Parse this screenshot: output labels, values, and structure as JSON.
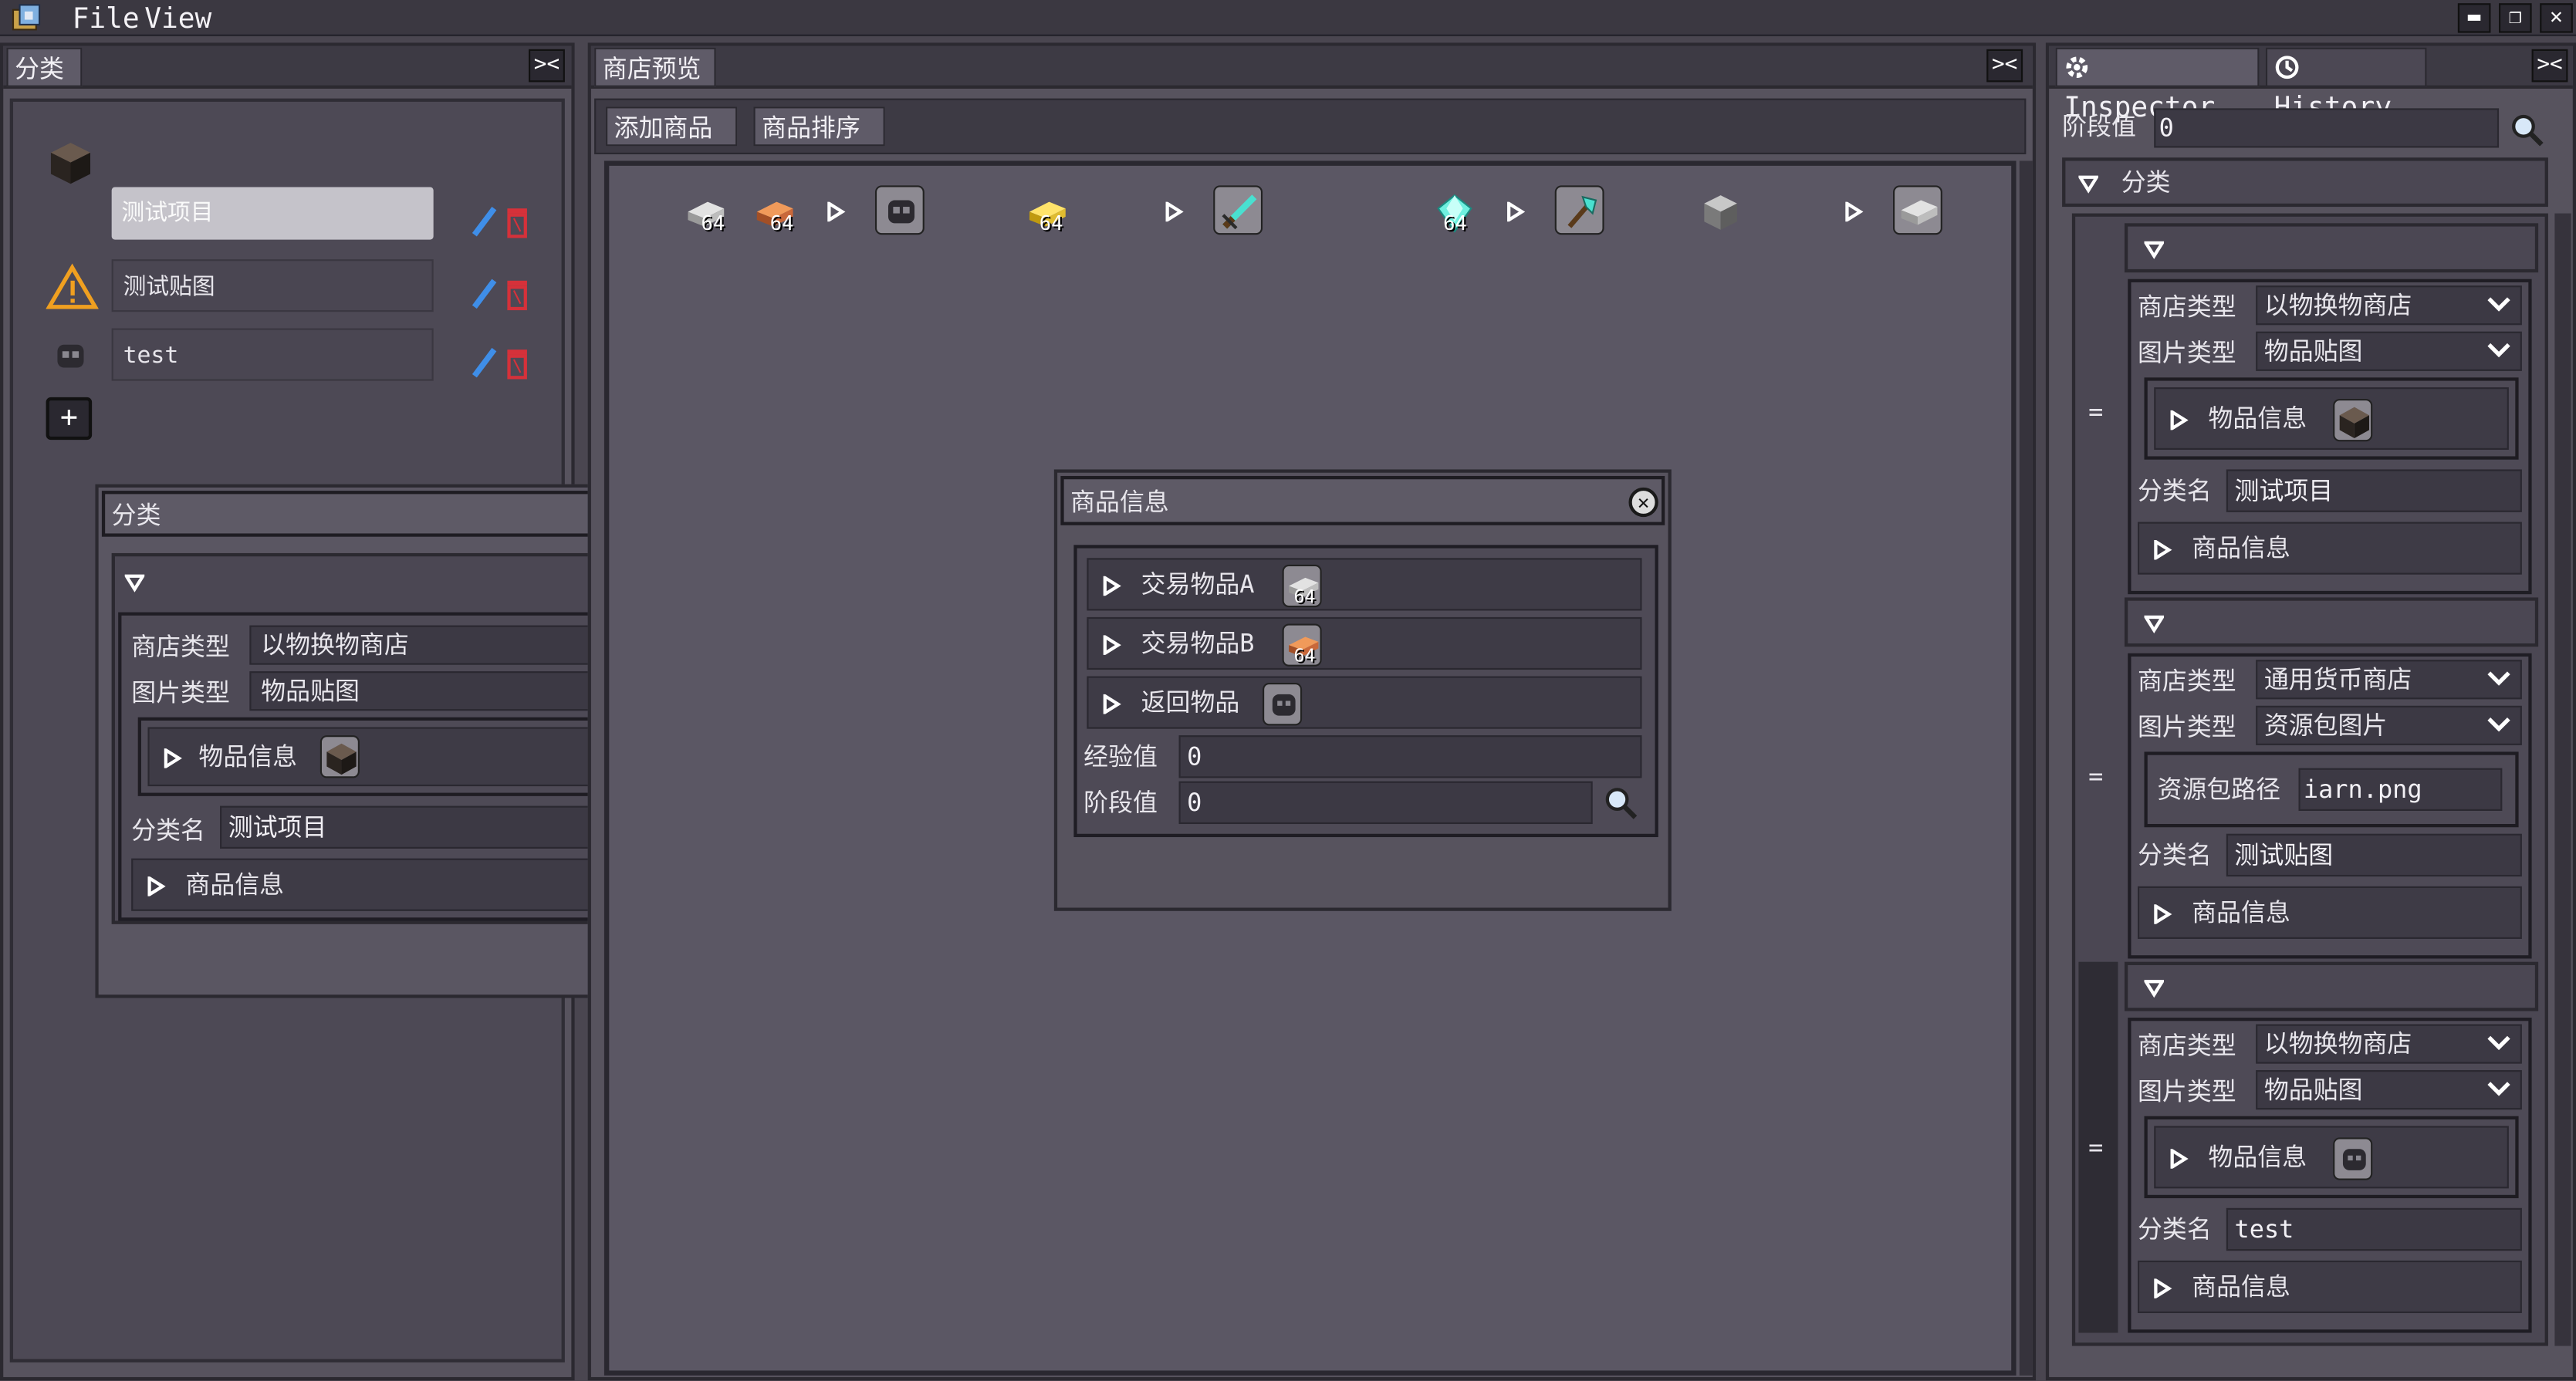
{
  "menubar": {
    "file": "File",
    "view": "View"
  },
  "left_panel": {
    "tab": "分类",
    "categories": [
      {
        "label": "测试项目"
      },
      {
        "label": "测试贴图"
      },
      {
        "label": "test"
      }
    ],
    "add": "+"
  },
  "float_category": {
    "title": "分类",
    "shop_type_label": "商店类型",
    "shop_type_value": "以物换物商店",
    "image_type_label": "图片类型",
    "image_type_value": "物品贴图",
    "item_info": "物品信息",
    "category_name_label": "分类名",
    "category_name_value": "测试项目",
    "goods_info": "商品信息"
  },
  "center_panel": {
    "tab": "商店预览",
    "toolbar": {
      "add_goods": "添加商品",
      "sort_goods": "商品排序"
    },
    "stack_count": "64"
  },
  "goods_popup": {
    "title": "商品信息",
    "trade_a": "交易物品A",
    "trade_b": "交易物品B",
    "return_item": "返回物品",
    "exp_label": "经验值",
    "exp_value": "0",
    "stage_label": "阶段值",
    "stage_value": "0",
    "badge": "64"
  },
  "inspector": {
    "tab_inspector": "Inspector",
    "tab_history": "History",
    "stage_label": "阶段值",
    "stage_value": "0",
    "category_header": "分类",
    "groups": [
      {
        "shop_type_label": "商店类型",
        "shop_type_value": "以物换物商店",
        "image_type_label": "图片类型",
        "image_type_value": "物品贴图",
        "item_info": "物品信息",
        "name_label": "分类名",
        "name_value": "测试项目",
        "goods_info": "商品信息"
      },
      {
        "shop_type_label": "商店类型",
        "shop_type_value": "通用货币商店",
        "image_type_label": "图片类型",
        "image_type_value": "资源包图片",
        "path_label": "资源包路径",
        "path_value": "iarn.png",
        "name_label": "分类名",
        "name_value": "测试贴图",
        "goods_info": "商品信息"
      },
      {
        "shop_type_label": "商店类型",
        "shop_type_value": "以物换物商店",
        "image_type_label": "图片类型",
        "image_type_value": "物品贴图",
        "item_info": "物品信息",
        "name_label": "分类名",
        "name_value": "test",
        "goods_info": "商品信息"
      }
    ],
    "drag_handle": "="
  },
  "colors": {
    "edit": "#3f8ee8",
    "delete": "#d6313a",
    "warning": "#f0a020",
    "background": "#4a4650"
  }
}
